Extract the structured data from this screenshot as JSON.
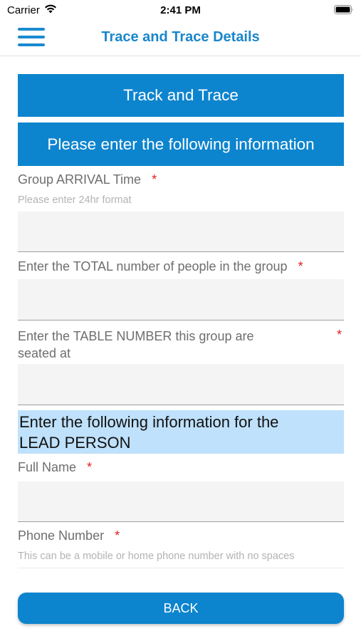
{
  "status_bar": {
    "carrier": "Carrier",
    "time": "2:41 PM"
  },
  "nav": {
    "title": "Trace and Trace Details"
  },
  "banners": {
    "primary": "Track and Trace",
    "secondary": "Please enter the following information"
  },
  "form": {
    "arrival_time": {
      "label": "Group ARRIVAL Time",
      "required_mark": "*",
      "hint": "Please enter 24hr format",
      "value": ""
    },
    "total_people": {
      "label": "Enter the TOTAL number of people in the group",
      "required_mark": "*",
      "value": ""
    },
    "table_number": {
      "label_line1": "Enter the TABLE NUMBER this group are",
      "label_line2": "seated at",
      "required_mark": "*",
      "value": ""
    },
    "lead_section": {
      "line1": "Enter the following information for the",
      "line2": "LEAD PERSON"
    },
    "full_name": {
      "label": "Full Name",
      "required_mark": "*",
      "value": ""
    },
    "phone_number": {
      "label": "Phone Number",
      "required_mark": "*",
      "hint": "This can be a mobile or home phone number with no spaces"
    }
  },
  "actions": {
    "back_label": "BACK"
  },
  "colors": {
    "accent": "#0d84ce",
    "title": "#1a86cb",
    "section_bg": "#bfe1fb",
    "required": "#e02020"
  },
  "icons": {
    "menu": "hamburger-icon",
    "wifi": "wifi-icon",
    "battery": "battery-icon"
  }
}
